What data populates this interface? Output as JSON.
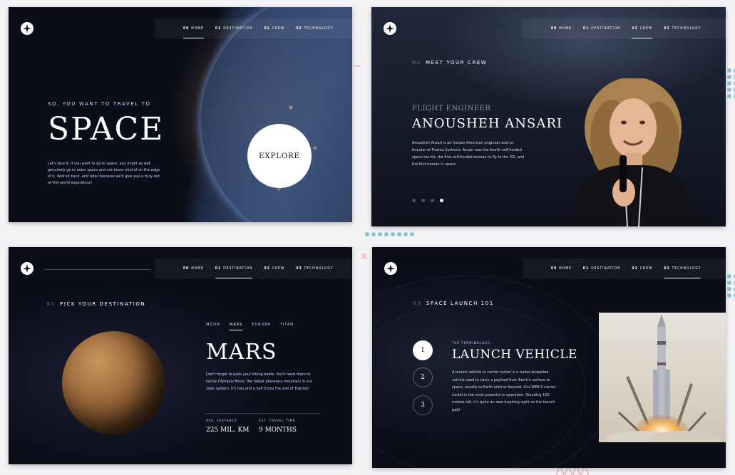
{
  "nav": [
    {
      "num": "00",
      "label": "HOME"
    },
    {
      "num": "01",
      "label": "DESTINATION"
    },
    {
      "num": "02",
      "label": "CREW"
    },
    {
      "num": "03",
      "label": "TECHNOLOGY"
    }
  ],
  "home": {
    "subtitle": "SO, YOU WANT TO TRAVEL TO",
    "title": "SPACE",
    "text": "Let's face it; if you want to go to space, you might as well genuinely go to outer space and not hover kind of on the edge of it. Well sit back, and relax because we'll give you a truly out of this world experience!",
    "explore": "EXPLORE"
  },
  "crew": {
    "heading_num": "02",
    "heading": "MEET YOUR CREW",
    "role": "FLIGHT ENGINEER",
    "name": "ANOUSHEH ANSARI",
    "bio": "Anousheh Ansari is an Iranian American engineer and co-founder of Prodea Systems. Ansari was the fourth self-funded space tourist, the first self-funded woman to fly to the ISS, and the first Iranian in space."
  },
  "destination": {
    "heading_num": "01",
    "heading": "PICK YOUR DESTINATION",
    "tabs": [
      "MOON",
      "MARS",
      "EUROPA",
      "TITAN"
    ],
    "name": "MARS",
    "description": "Don't forget to pack your hiking boots. You'll need them to tackle Olympus Mons, the tallest planetary mountain in our solar system. It's two and a half times the size of Everest!",
    "distance_label": "AVG. DISTANCE",
    "distance_value": "225 MIL. KM",
    "travel_label": "EST. TRAVEL TIME",
    "travel_value": "9 MONTHS"
  },
  "technology": {
    "heading_num": "03",
    "heading": "SPACE LAUNCH 101",
    "numbers": [
      "1",
      "2",
      "3"
    ],
    "terminology": "THE TERMINOLOGY...",
    "name": "LAUNCH VEHICLE",
    "description": "A launch vehicle or carrier rocket is a rocket-propelled vehicle used to carry a payload from Earth's surface to space, usually to Earth orbit or beyond. Our WEB-X carrier rocket is the most powerful in operation. Standing 150 metres tall, it's quite an awe-inspiring sight on the launch pad!"
  }
}
